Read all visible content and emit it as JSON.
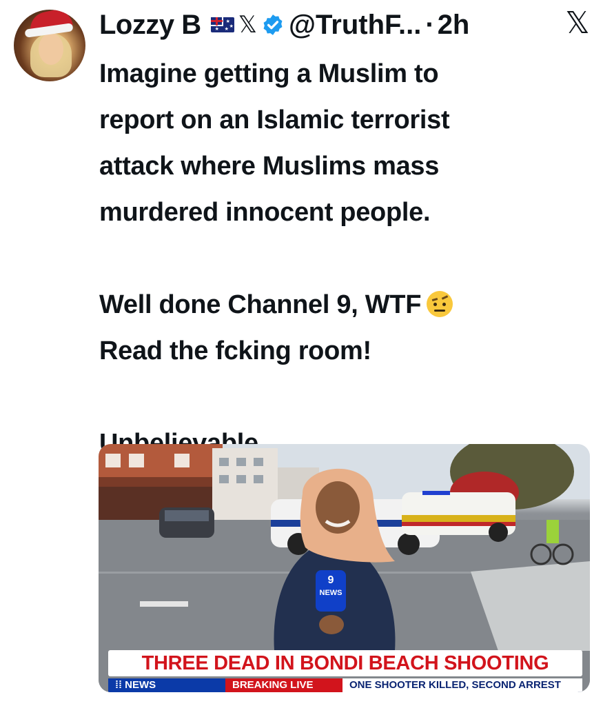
{
  "author": {
    "name": "Lozzy B",
    "handle": "@TruthF...",
    "separator": "·",
    "time": "2h",
    "flag_icon": "australia-flag-icon",
    "x_icon": "x-logo-icon",
    "verified_icon": "verified-badge-icon"
  },
  "close_label": "𝕏",
  "tweet": {
    "line1": "Imagine getting a Muslim to",
    "line2": "report on an Islamic terrorist",
    "line3": "attack where Muslims mass",
    "line4": "murdered  innocent people.",
    "line5": "Well done Channel 9, WTF",
    "line6": "Read the fcking room!",
    "line7": "Unbelievable",
    "emoji": "raised-eyebrow-emoji"
  },
  "media": {
    "chyron": "THREE DEAD IN BONDI BEACH SHOOTING",
    "ticker_logo": "⁞⁞ NEWS",
    "ticker_live": "BREAKING LIVE",
    "ticker_text": "ONE SHOOTER KILLED, SECOND ARREST",
    "mic_label": "9",
    "mic_sub": "NEWS"
  },
  "colors": {
    "text": "#0f1419",
    "verified": "#1d9bf0",
    "chyron_red": "#d2141c",
    "news_blue": "#0a2472"
  }
}
